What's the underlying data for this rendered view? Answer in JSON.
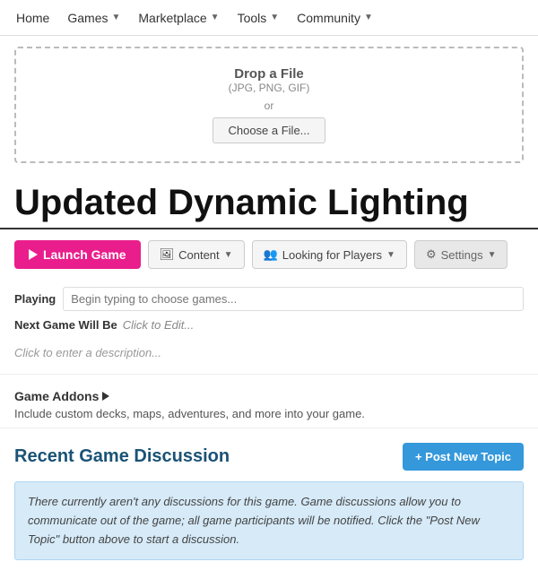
{
  "nav": {
    "items": [
      {
        "label": "Home",
        "has_arrow": false
      },
      {
        "label": "Games",
        "has_arrow": true
      },
      {
        "label": "Marketplace",
        "has_arrow": true
      },
      {
        "label": "Tools",
        "has_arrow": true
      },
      {
        "label": "Community",
        "has_arrow": true
      }
    ]
  },
  "upload": {
    "title": "Drop a File",
    "subtitle": "(JPG, PNG, GIF)",
    "or": "or",
    "button_label": "Choose a File..."
  },
  "page": {
    "title": "Updated Dynamic Lighting"
  },
  "actions": {
    "launch_label": "Launch Game",
    "content_label": "Content",
    "looking_label": "Looking for Players",
    "settings_label": "Settings"
  },
  "form": {
    "playing_label": "Playing",
    "playing_placeholder": "Begin typing to choose games...",
    "next_game_label": "Next Game Will Be",
    "next_game_placeholder": "Click to Edit...",
    "description_placeholder": "Click to enter a description..."
  },
  "addons": {
    "title": "Game Addons",
    "description": "Include custom decks, maps, adventures, and more into your game."
  },
  "discussion": {
    "title": "Recent Game Discussion",
    "post_button": "+ Post New Topic",
    "empty_message": "There currently aren't any discussions for this game. Game discussions allow you to communicate out of the game; all game participants will be notified. Click the \"Post New Topic\" button above to start a discussion."
  }
}
